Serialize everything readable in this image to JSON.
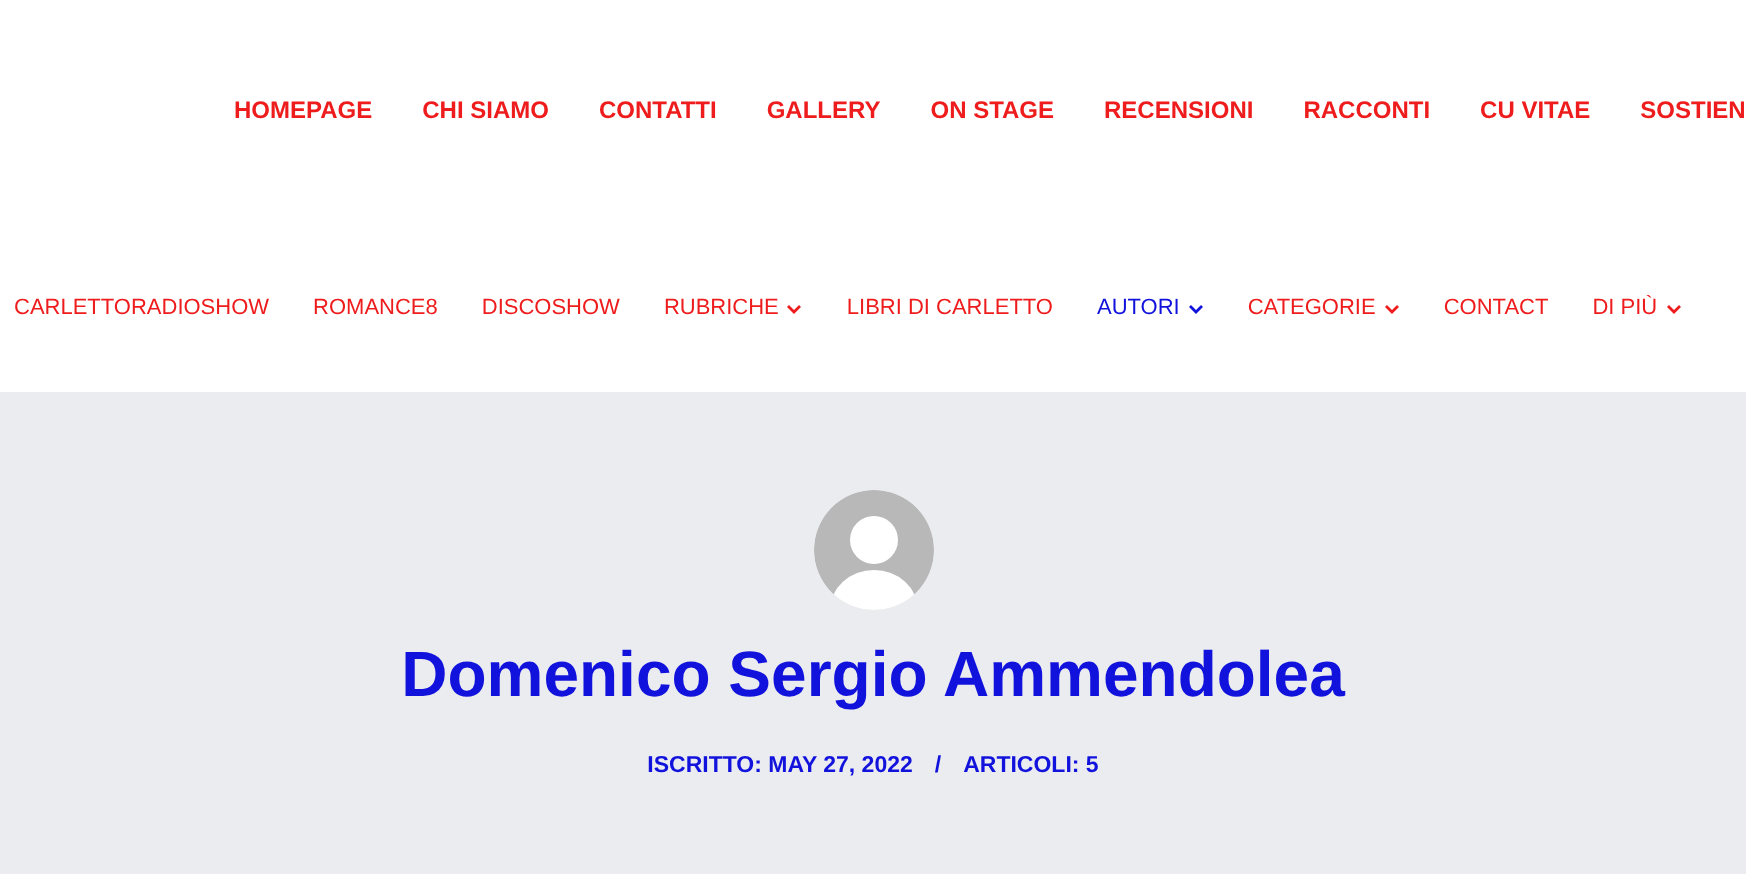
{
  "primary_menu": [
    {
      "label": "HOMEPAGE"
    },
    {
      "label": "CHI SIAMO"
    },
    {
      "label": "CONTATTI"
    },
    {
      "label": "GALLERY"
    },
    {
      "label": "ON STAGE"
    },
    {
      "label": "RECENSIONI"
    },
    {
      "label": "RACCONTI"
    },
    {
      "label": "CU VITAE"
    },
    {
      "label": "SOSTIEN"
    }
  ],
  "secondary_menu": [
    {
      "label": "CARLETTORADIOSHOW",
      "selected": false,
      "has_submenu": false
    },
    {
      "label": "ROMANCE8",
      "selected": false,
      "has_submenu": false
    },
    {
      "label": "DISCOSHOW",
      "selected": false,
      "has_submenu": false
    },
    {
      "label": "RUBRICHE",
      "selected": false,
      "has_submenu": true
    },
    {
      "label": "LIBRI DI CARLETTO",
      "selected": false,
      "has_submenu": false
    },
    {
      "label": "AUTORI",
      "selected": true,
      "has_submenu": true
    },
    {
      "label": "CATEGORIE",
      "selected": false,
      "has_submenu": true
    },
    {
      "label": "CONTACT",
      "selected": false,
      "has_submenu": false
    },
    {
      "label": "DI PIÙ",
      "selected": false,
      "has_submenu": true
    }
  ],
  "author": {
    "name": "Domenico Sergio Ammendolea",
    "joined": "ISCRITTO: MAY 27, 2022",
    "separator": "/",
    "articles": "ARTICOLI: 5"
  }
}
